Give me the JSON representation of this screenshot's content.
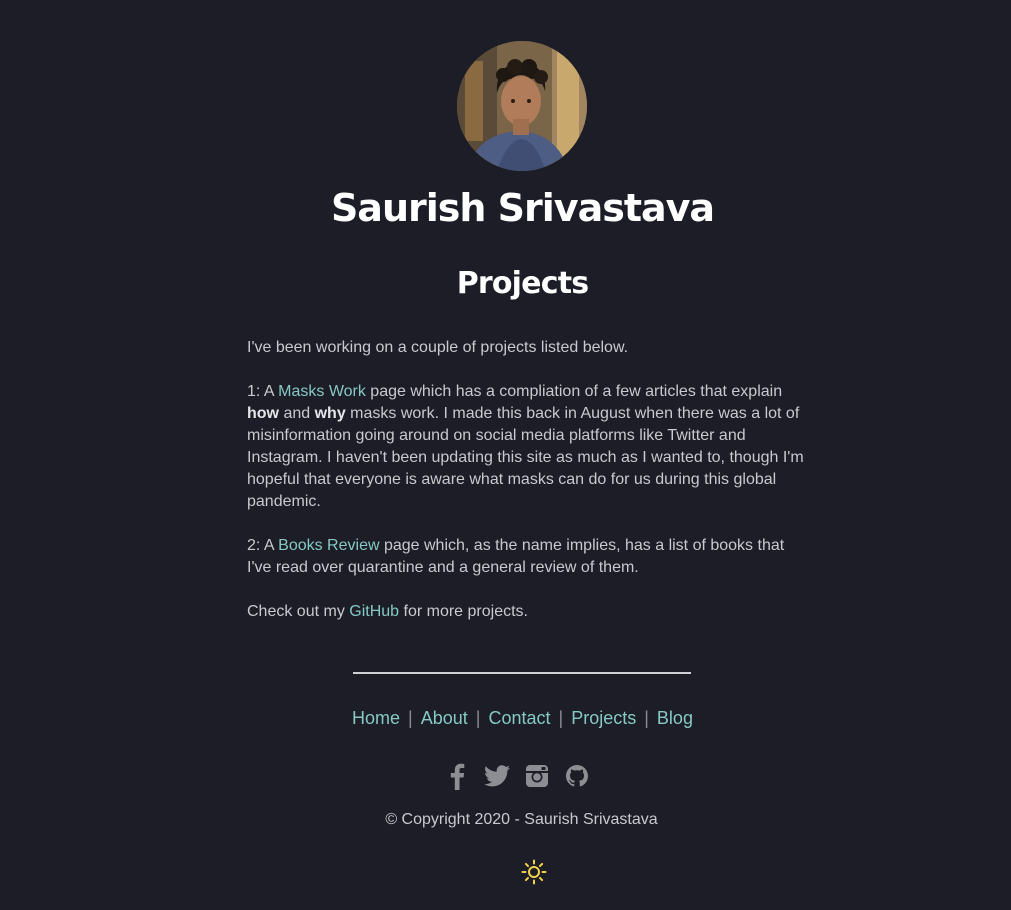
{
  "header": {
    "site_title": "Saurish Srivastava",
    "page_heading": "Projects"
  },
  "content": {
    "intro": "I've been working on a couple of projects listed below.",
    "project1": {
      "prefix": "1: A ",
      "link_label": "Masks Work",
      "text_a": " page which has a compliation of a few articles that explain ",
      "bold_how": "how",
      "text_b": " and ",
      "bold_why": "why",
      "text_c": " masks work. I made this back in August when there was a lot of misinformation going around on social media platforms like Twitter and Instagram. I haven't been updating this site as much as I wanted to, though I'm hopeful that everyone is aware what masks can do for us during this global pandemic."
    },
    "project2": {
      "prefix": "2: A ",
      "link_label": "Books Review",
      "text": " page which, as the name implies, has a list of books that I've read over quarantine and a general review of them."
    },
    "github_line": {
      "prefix": "Check out my ",
      "link_label": "GitHub",
      "suffix": " for more projects."
    }
  },
  "footer": {
    "nav": [
      {
        "label": "Home"
      },
      {
        "label": "About"
      },
      {
        "label": "Contact"
      },
      {
        "label": "Projects"
      },
      {
        "label": "Blog"
      }
    ],
    "separator": "|",
    "social_icons": [
      "facebook-icon",
      "twitter-icon",
      "instagram-icon",
      "github-icon"
    ],
    "copyright": "© Copyright 2020 - Saurish Srivastava",
    "theme_toggle_icon": "sun-icon"
  },
  "colors": {
    "background": "#1c1d26",
    "link": "#86c9c4",
    "text": "#c9c9cf",
    "heading": "#ffffff",
    "icon": "#8d8d94",
    "sun": "#f2d24b"
  }
}
